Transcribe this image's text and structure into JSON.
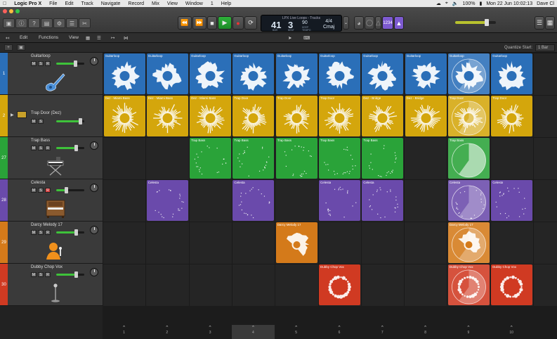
{
  "menubar": {
    "app": "Logic Pro X",
    "items": [
      "File",
      "Edit",
      "Track",
      "Navigate",
      "Record",
      "Mix",
      "View",
      "Window",
      "1",
      "Help"
    ],
    "battery": "100%",
    "clock": "Mon 22 Jun  10:02:13",
    "user": "Dave Cl"
  },
  "window": {
    "title": "LPX Live Loops - Tracks"
  },
  "lcd": {
    "bar": "41",
    "beat": "3",
    "bar_label": "BAR",
    "beat_label": "BEAT",
    "tempo": "90",
    "tempo_label": "KEEP",
    "tempo_sub": "TEMPO",
    "signature": "4/4",
    "key": "Cmaj"
  },
  "toolbar": {
    "count_in": "1234"
  },
  "edit_bar": {
    "edit": "Edit",
    "functions": "Functions",
    "view": "View"
  },
  "sub_bar": {
    "quantize_label": "Quantize Start:",
    "quantize_value": "1 Bar"
  },
  "tracks": [
    {
      "num": "1",
      "name": "Guitarloop",
      "color": "#2b6fb8",
      "fader": 0.68,
      "instrument": "guitar-icon"
    },
    {
      "num": "2",
      "name": "Trap Door (Dez)",
      "color": "#d4a60c",
      "fader": 0.86,
      "instrument": "none"
    },
    {
      "num": "27",
      "name": "Trap Bass",
      "color": "#2aa339",
      "fader": 0.72,
      "instrument": "keyboard-stand-icon"
    },
    {
      "num": "28",
      "name": "Celesta",
      "color": "#6a4aab",
      "fader": 0.36,
      "instrument": "celesta-icon"
    },
    {
      "num": "29",
      "name": "Darcy Melody 17",
      "color": "#d47a1a",
      "fader": 0.72,
      "instrument": "singer-icon"
    },
    {
      "num": "30",
      "name": "Dubby Chop Vox",
      "color": "#d03a22",
      "fader": 0.72,
      "instrument": "microphone-icon"
    }
  ],
  "grid": {
    "rows": [
      [
        {
          "c": 0,
          "label": "Guitarloop",
          "type": "wave"
        },
        {
          "c": 1,
          "label": "Guitarloop",
          "type": "wave"
        },
        {
          "c": 2,
          "label": "Guitarloop",
          "type": "wave"
        },
        {
          "c": 3,
          "label": "Guitarloop",
          "type": "wave"
        },
        {
          "c": 4,
          "label": "Guitarloop",
          "type": "wave"
        },
        {
          "c": 5,
          "label": "Guitarloop",
          "type": "wave"
        },
        {
          "c": 6,
          "label": "Guitarloop",
          "type": "wave"
        },
        {
          "c": 7,
          "label": "Guitarloop",
          "type": "wave"
        },
        {
          "c": 8,
          "label": "Guitarloop",
          "type": "wave",
          "playing": true,
          "progress": 0.6
        },
        {
          "c": 9,
          "label": "Guitarloop",
          "type": "wave"
        }
      ],
      [
        {
          "c": 0,
          "label": "Dez - Miami Bass",
          "type": "burst"
        },
        {
          "c": 1,
          "label": "Dez - Miami Bass",
          "type": "burst"
        },
        {
          "c": 2,
          "label": "Dez - Miami Bass",
          "type": "burst"
        },
        {
          "c": 3,
          "label": "Trap Door",
          "type": "burst"
        },
        {
          "c": 4,
          "label": "Trap Door",
          "type": "burst"
        },
        {
          "c": 5,
          "label": "Trap Door",
          "type": "burst"
        },
        {
          "c": 6,
          "label": "Dez - Bridge",
          "type": "burst"
        },
        {
          "c": 7,
          "label": "Dez - Bridge",
          "type": "burst"
        },
        {
          "c": 8,
          "label": "Trap Door",
          "type": "burst",
          "playing": true,
          "progress": 0.6
        },
        {
          "c": 9,
          "label": "Trap Door",
          "type": "burst"
        }
      ],
      [
        {
          "c": 2,
          "label": "Trap Bass",
          "type": "dots"
        },
        {
          "c": 3,
          "label": "Trap Bass",
          "type": "dots"
        },
        {
          "c": 4,
          "label": "Trap Bass",
          "type": "dots"
        },
        {
          "c": 5,
          "label": "Trap Bass",
          "type": "dots"
        },
        {
          "c": 6,
          "label": "Trap Bass",
          "type": "dots"
        },
        {
          "c": 8,
          "label": "Trap Bass",
          "type": "pie",
          "playing": true,
          "progress": 0.6
        }
      ],
      [
        {
          "c": 1,
          "label": "Celesta",
          "type": "dots"
        },
        {
          "c": 3,
          "label": "Celesta",
          "type": "dots"
        },
        {
          "c": 5,
          "label": "Celesta",
          "type": "dots"
        },
        {
          "c": 6,
          "label": "Celesta",
          "type": "dots"
        },
        {
          "c": 8,
          "label": "Celesta",
          "type": "dots",
          "playing": true,
          "progress": 0.6
        },
        {
          "c": 9,
          "label": "Celesta",
          "type": "dots"
        }
      ],
      [
        {
          "c": 4,
          "label": "Darcy Melody 17",
          "type": "blob"
        },
        {
          "c": 8,
          "label": "Darcy Melody 17",
          "type": "blob",
          "playing": true,
          "progress": 0.6
        }
      ],
      [
        {
          "c": 5,
          "label": "Dubby Chop Vox",
          "type": "ring"
        },
        {
          "c": 8,
          "label": "Dubby Chop Vox",
          "type": "ring",
          "playing": true,
          "progress": 0.6
        },
        {
          "c": 9,
          "label": "Dubby Chop Vox",
          "type": "ring"
        }
      ]
    ]
  },
  "scenes": [
    "1",
    "2",
    "3",
    "4",
    "5",
    "6",
    "7",
    "8",
    "9",
    "10"
  ],
  "active_scene": 3
}
